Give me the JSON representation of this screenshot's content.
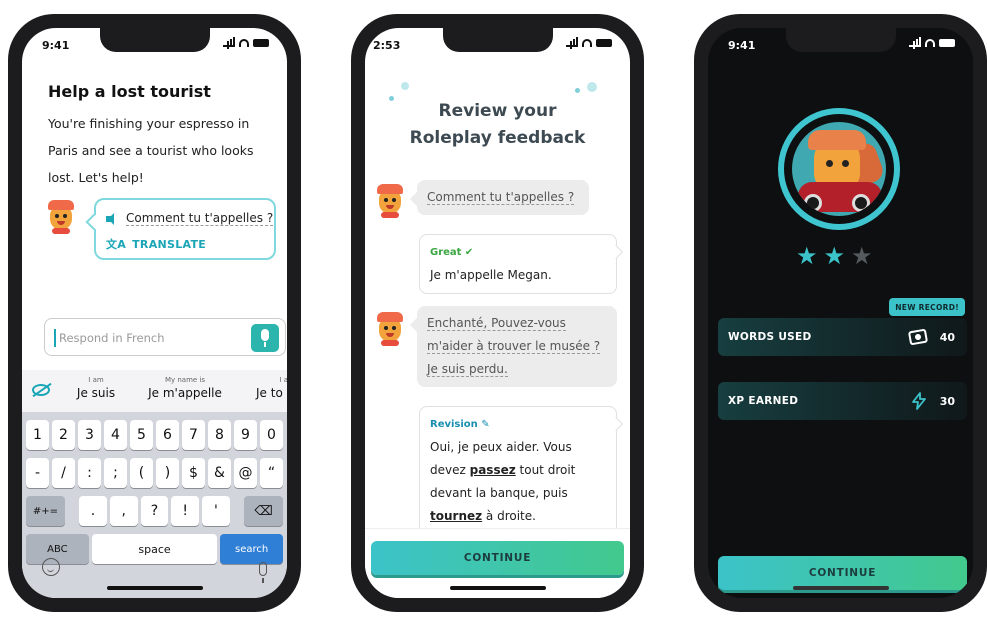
{
  "colors": {
    "accent": "#1aa6b7",
    "continue_start": "#3cc3c9",
    "continue_end": "#42c98d",
    "great": "#3aa641",
    "star_filled": "#3cc3c9",
    "star_empty": "#555a5e",
    "keyboard_blue": "#2f7fd6"
  },
  "phone1": {
    "status_time": "9:41",
    "title": "Help a lost tourist",
    "description": "You're finishing your espresso in Paris and see a tourist who looks lost. Let's help!",
    "bubble": {
      "speaker_icon": "speaker-icon",
      "text": "Comment tu t'appelles ?",
      "translate_icon": "translate-icon",
      "translate_label": "TRANSLATE"
    },
    "input": {
      "placeholder": "Respond in French",
      "mic_icon": "microphone-icon"
    },
    "suggestions": [
      {
        "hint": "I am",
        "word": "Je suis"
      },
      {
        "hint": "My name is",
        "word": "Je m'appelle"
      },
      {
        "hint": "I a",
        "word": "Je to"
      }
    ],
    "keyboard": {
      "row1": [
        "1",
        "2",
        "3",
        "4",
        "5",
        "6",
        "7",
        "8",
        "9",
        "0"
      ],
      "row2": [
        "-",
        "/",
        ":",
        ";",
        "(",
        ")",
        "$",
        "&",
        "@",
        "“"
      ],
      "row3_left": "#+=",
      "row3": [
        ".",
        ",",
        "?",
        "!",
        "'"
      ],
      "row3_delete": "⌫",
      "abc": "ABC",
      "space": "space",
      "search": "search"
    }
  },
  "phone2": {
    "status_time": "2:53",
    "title_line1": "Review your",
    "title_line2": "Roleplay feedback",
    "messages": {
      "m1": "Comment tu t'appelles ?",
      "m2_label": "Great ✔",
      "m2_text": "Je m'appelle Megan.",
      "m3_line1": "Enchanté, Pouvez-vous",
      "m3_line2": "m'aider à trouver le musée ?",
      "m3_line3": "Je suis perdu.",
      "m4_label": "Revision ✎",
      "m4_line1": "Oui, je peux aider. Vous",
      "m4_line2_a": "devez ",
      "m4_line2_b": "passez",
      "m4_line2_c": " tout droit",
      "m4_line3": "devant la banque, puis",
      "m4_line4_a": "tournez",
      "m4_line4_b": " à droite."
    },
    "continue_label": "CONTINUE"
  },
  "phone3": {
    "status_time": "9:41",
    "stars": {
      "filled": 2,
      "total": 3
    },
    "new_record": "NEW RECORD!",
    "stats": [
      {
        "label": "WORDS USED",
        "icon": "cards-icon",
        "value": "40"
      },
      {
        "label": "XP EARNED",
        "icon": "bolt-icon",
        "value": "30"
      }
    ],
    "continue_label": "CONTINUE"
  }
}
